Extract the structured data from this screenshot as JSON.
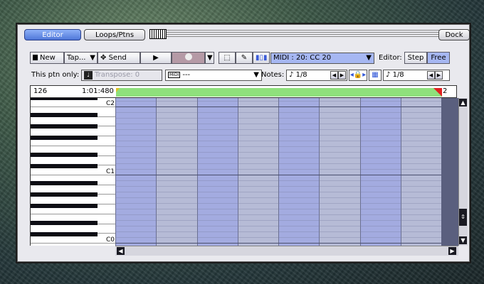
{
  "tabs": [
    {
      "label": "Editor",
      "active": true
    },
    {
      "label": "Loops/Ptns",
      "active": false
    }
  ],
  "dock_label": "Dock",
  "toolbar": {
    "new_label": "New",
    "tap_label": "Tap...",
    "send_label": "Send",
    "midi_channel": "MIDI : 20: CC 20",
    "editor_label": "Editor:",
    "step_label": "Step",
    "free_label": "Free"
  },
  "row2": {
    "this_ptn_label": "This ptn only:",
    "transpose_label": "Transpose: 0",
    "midi_badge": "MIDI",
    "midi_select": "---",
    "notes_label": "Notes:",
    "note_value_1": "1/8",
    "note_value_2": "1/8"
  },
  "ruler": {
    "position": "126",
    "time": "1:01:480",
    "marker_end": "2"
  },
  "piano": {
    "labels": [
      "C2",
      "C1",
      "C0"
    ]
  },
  "colors": {
    "active_tab": "#5b82e0",
    "loop_region": "#8fe07c",
    "loop_end_marker": "#e02020",
    "grid_base": "#b6bbd6",
    "grid_stripe": "#a3abe0",
    "frame_bg": "#2f4a44"
  }
}
